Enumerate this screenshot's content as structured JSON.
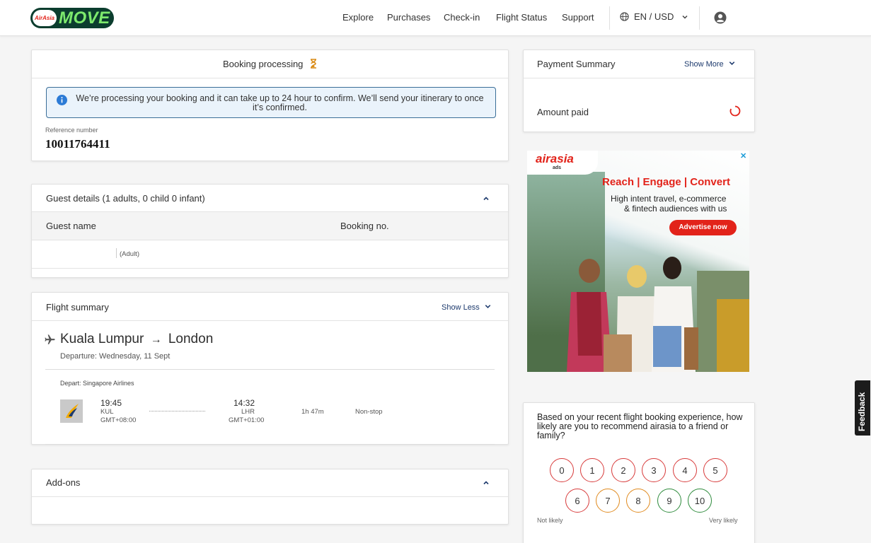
{
  "header": {
    "logo_badge": "AirAsia",
    "logo_word": "MOVE",
    "nav": [
      "Explore",
      "Purchases",
      "Check-in",
      "Flight Status",
      "Support"
    ],
    "lang": "EN / USD"
  },
  "booking": {
    "title": "Booking processing",
    "notice": "We’re processing your booking and it can take up to 24 hour to confirm. We’ll send your itinerary to once it’s confirmed.",
    "ref_label": "Reference number",
    "ref_number": "10011764411"
  },
  "guests": {
    "title": "Guest details (1 adults, 0 child 0 infant)",
    "col_name": "Guest name",
    "col_booking": "Booking no.",
    "row_type": "(Adult)"
  },
  "flight": {
    "title": "Flight summary",
    "toggle": "Show Less",
    "origin": "Kuala Lumpur",
    "destination": "London",
    "departure": "Departure: Wednesday, 11 Sept",
    "airline_label": "Depart: Singapore Airlines",
    "dep_time": "19:45",
    "dep_code": "KUL",
    "dep_tz": "GMT+08:00",
    "arr_time": "14:32",
    "arr_code": "LHR",
    "arr_tz": "GMT+01:00",
    "duration": "1h 47m",
    "stops": "Non-stop"
  },
  "addons": {
    "title": "Add-ons"
  },
  "payment": {
    "title": "Payment Summary",
    "toggle": "Show More",
    "amount_label": "Amount paid"
  },
  "ad": {
    "brand": "airasia",
    "brand_sub": "ads",
    "headline": "Reach | Engage | Convert",
    "body_line1": "High intent travel, e-commerce",
    "body_line2": "& fintech audiences with us",
    "cta": "Advertise now"
  },
  "survey": {
    "question": "Based on your recent flight booking experience, how likely are you to recommend airasia to a friend or family?",
    "scale": [
      "0",
      "1",
      "2",
      "3",
      "4",
      "5",
      "6",
      "7",
      "8",
      "9",
      "10"
    ],
    "low_label": "Not likely",
    "high_label": "Very likely"
  },
  "feedback": "Feedback",
  "colors": {
    "accent_red": "#d83c3c",
    "amber": "#e08a1e",
    "green": "#2e8b3c",
    "navy": "#1d3a6d",
    "logo_bg": "#0b3d2e",
    "logo_text": "#7dea6d"
  }
}
